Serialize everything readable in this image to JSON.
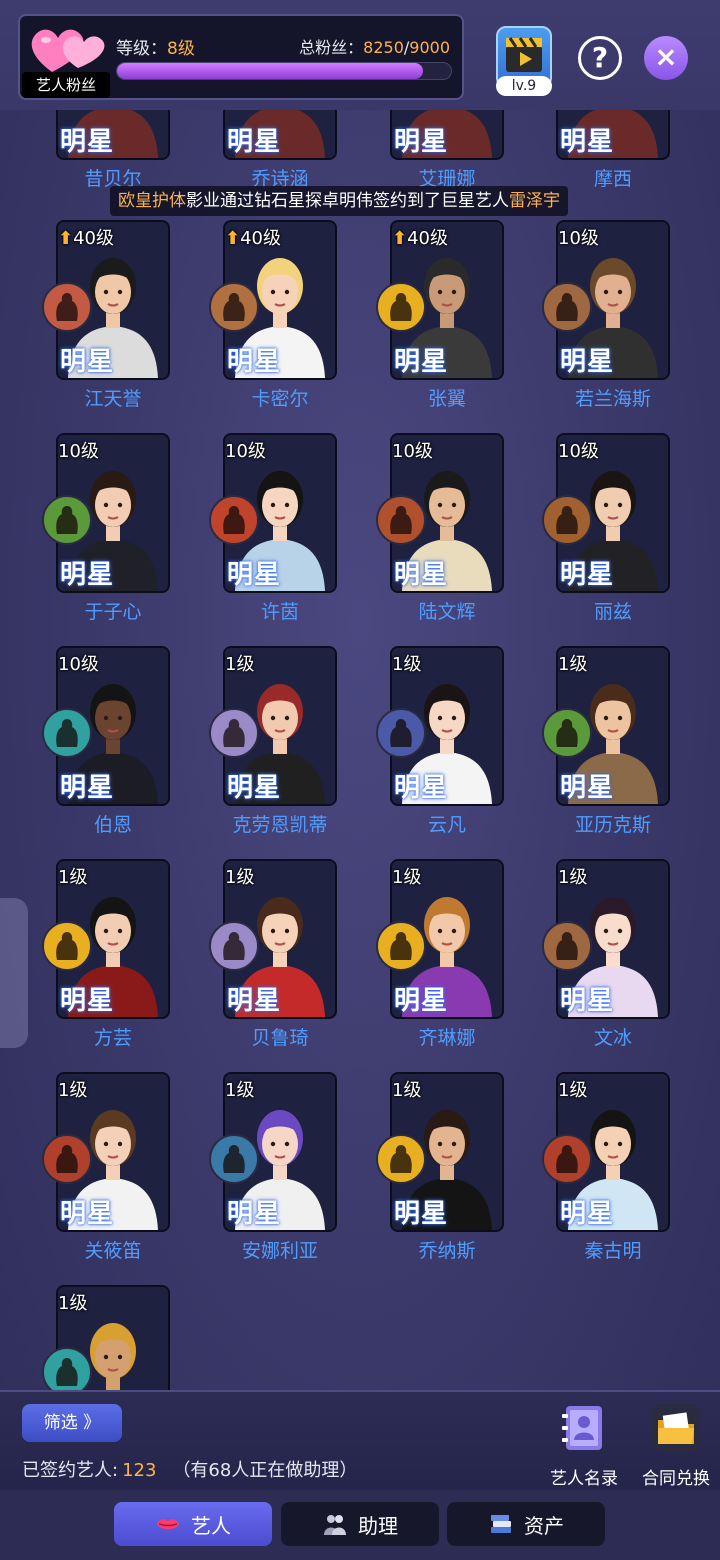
{
  "header": {
    "fan_tag": "艺人粉丝",
    "level_label": "等级：",
    "level_value": "8级",
    "fans_label": "总粉丝：",
    "fans_current": "8250",
    "fans_sep": "/",
    "fans_max": "9000",
    "fans_progress": 0.917,
    "clapper_level": "lv.9",
    "help_icon": "question-icon",
    "close_icon": "close-icon"
  },
  "notice": {
    "prefix": "欧皇护体",
    "body": "影业通过钻石星探卓明伟签约到了巨星艺人",
    "artist": "雷泽宇"
  },
  "card_tag": "明星",
  "top_row": [
    {
      "name": "昔贝尔"
    },
    {
      "name": "乔诗涵"
    },
    {
      "name": "艾珊娜"
    },
    {
      "name": "摩西"
    }
  ],
  "artists": [
    {
      "level": "40级",
      "up": true,
      "name": "江天誉",
      "badge": "#c25a44",
      "hair": "#1b1b1b",
      "cloth": "#dcdcdc",
      "skin": "#f0c8a8"
    },
    {
      "level": "40级",
      "up": true,
      "name": "卡密尔",
      "badge": "#b07040",
      "hair": "#f2d27a",
      "cloth": "#f4f4f4",
      "skin": "#f6d2b8"
    },
    {
      "level": "40级",
      "up": true,
      "name": "张翼",
      "badge": "#e8b020",
      "hair": "#2a2a2a",
      "cloth": "#3a3a3a",
      "skin": "#c89a78"
    },
    {
      "level": "10级",
      "up": false,
      "name": "若兰海斯",
      "badge": "#a06840",
      "hair": "#6a4a2a",
      "cloth": "#303030",
      "skin": "#e0b090"
    },
    {
      "level": "10级",
      "up": false,
      "name": "于子心",
      "badge": "#5a9a3a",
      "hair": "#2a1a14",
      "cloth": "#202028",
      "skin": "#f2cdb4"
    },
    {
      "level": "10级",
      "up": false,
      "name": "许茵",
      "badge": "#c0442c",
      "hair": "#141414",
      "cloth": "#b8d2e8",
      "skin": "#f6d6c0"
    },
    {
      "level": "10级",
      "up": false,
      "name": "陆文辉",
      "badge": "#b0502c",
      "hair": "#1a1a1a",
      "cloth": "#e8dcbc",
      "skin": "#e6bc98"
    },
    {
      "level": "10级",
      "up": false,
      "name": "丽兹",
      "badge": "#a06030",
      "hair": "#1a1412",
      "cloth": "#222226",
      "skin": "#f0ccb0"
    },
    {
      "level": "10级",
      "up": false,
      "name": "伯恩",
      "badge": "#30a0a0",
      "hair": "#141414",
      "cloth": "#1c1c24",
      "skin": "#6a4430"
    },
    {
      "level": "1级",
      "up": false,
      "name": "克劳恩凯蒂",
      "badge": "#9a8ac8",
      "hair": "#9a2a2a",
      "cloth": "#202020",
      "skin": "#f2cab0"
    },
    {
      "level": "1级",
      "up": false,
      "name": "云凡",
      "badge": "#4a5aa8",
      "hair": "#1a1414",
      "cloth": "#f4f4f4",
      "skin": "#f6d8c4"
    },
    {
      "level": "1级",
      "up": false,
      "name": "亚历克斯",
      "badge": "#5a9a3a",
      "hair": "#4a2c1a",
      "cloth": "#8a6a48",
      "skin": "#ecc4a0"
    },
    {
      "level": "1级",
      "up": false,
      "name": "方芸",
      "badge": "#e8b020",
      "hair": "#141414",
      "cloth": "#8a1a1a",
      "skin": "#f2cdb4"
    },
    {
      "level": "1级",
      "up": false,
      "name": "贝鲁琦",
      "badge": "#9a8ac8",
      "hair": "#4a2a1a",
      "cloth": "#c42a2a",
      "skin": "#f6d2b8"
    },
    {
      "level": "1级",
      "up": false,
      "name": "齐琳娜",
      "badge": "#e8b020",
      "hair": "#c07a30",
      "cloth": "#8a3ab0",
      "skin": "#f2c8a8"
    },
    {
      "level": "1级",
      "up": false,
      "name": "文冰",
      "badge": "#a06840",
      "hair": "#2a1a2a",
      "cloth": "#e8d8f0",
      "skin": "#f8dccc"
    },
    {
      "level": "1级",
      "up": false,
      "name": "关筱笛",
      "badge": "#b0402c",
      "hair": "#5a3a20",
      "cloth": "#f2f2f2",
      "skin": "#f4d0b8"
    },
    {
      "level": "1级",
      "up": false,
      "name": "安娜利亚",
      "badge": "#3a7aa8",
      "hair": "#6a4ac0",
      "cloth": "#f0f0f0",
      "skin": "#f6d6c6"
    },
    {
      "level": "1级",
      "up": false,
      "name": "乔纳斯",
      "badge": "#e8b020",
      "hair": "#2a1a14",
      "cloth": "#141414",
      "skin": "#e2b490"
    },
    {
      "level": "1级",
      "up": false,
      "name": "秦古明",
      "badge": "#b0402c",
      "hair": "#141414",
      "cloth": "#d0e6f4",
      "skin": "#f4d0b4"
    },
    {
      "level": "1级",
      "up": false,
      "name": "",
      "badge": "#30a0a0",
      "hair": "#d8a030",
      "cloth": "#3a2a20",
      "skin": "#d4a070"
    }
  ],
  "bottom": {
    "filter_label": "筛选 》",
    "signed_label": "已签约艺人:",
    "signed_count": "123",
    "signed_note": "（有68人正在做助理）",
    "list_label": "艺人名录",
    "exchange_label": "合同兑换"
  },
  "tabs": [
    {
      "label": "艺人",
      "icon": "lips-icon",
      "active": true
    },
    {
      "label": "助理",
      "icon": "assistant-icon",
      "active": false
    },
    {
      "label": "资产",
      "icon": "books-icon",
      "active": false
    }
  ],
  "colors": {
    "accent_orange": "#ffb347",
    "name_blue": "#4f9cff",
    "tab_active": "#5b5de0"
  }
}
